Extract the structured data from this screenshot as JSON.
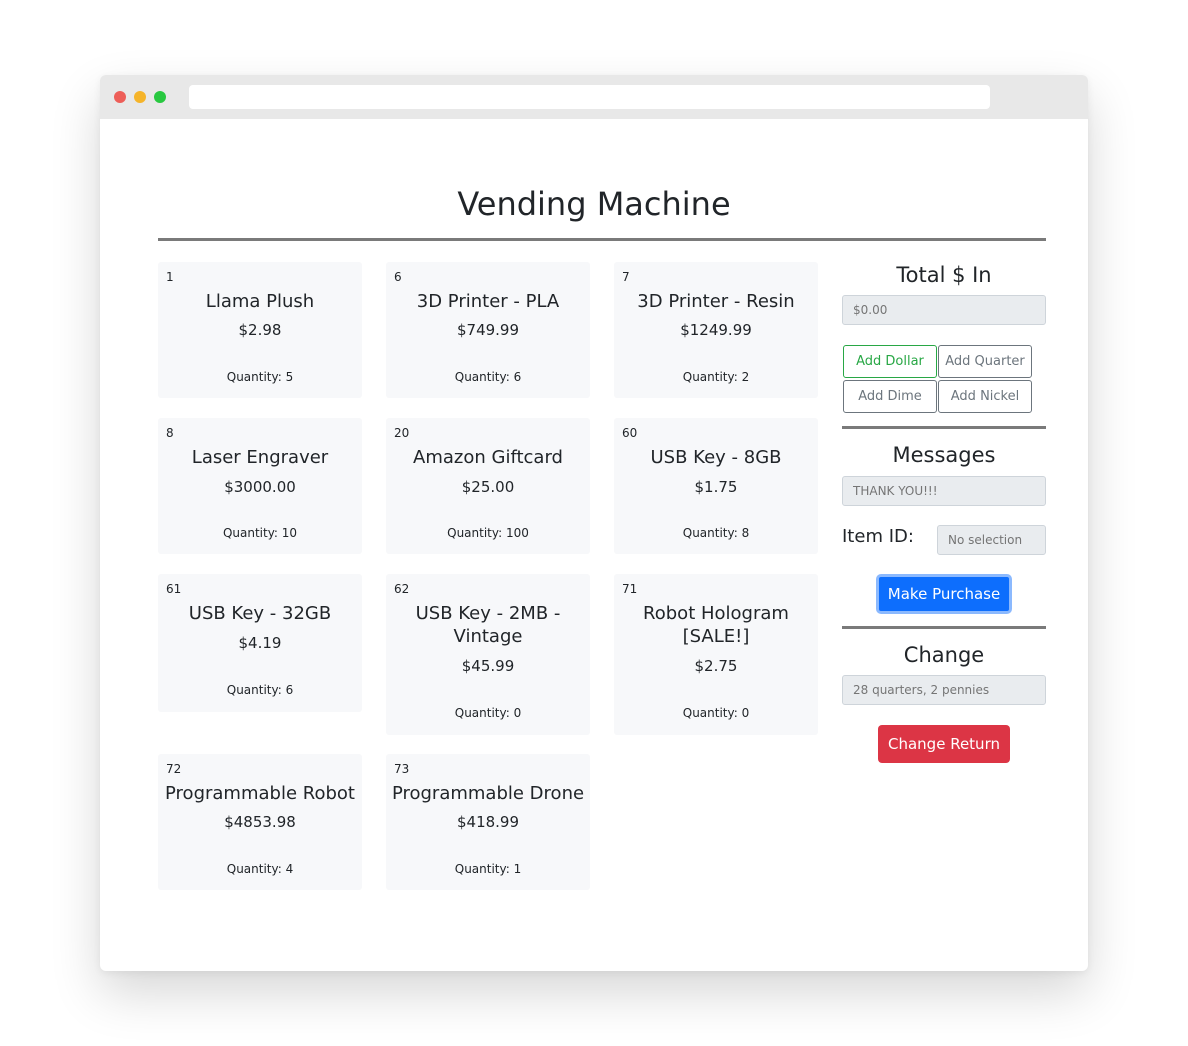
{
  "page": {
    "title": "Vending Machine"
  },
  "items": [
    {
      "id": "1",
      "name": "Llama Plush",
      "price": "$2.98",
      "quantity": "Quantity: 5"
    },
    {
      "id": "6",
      "name": "3D Printer - PLA",
      "price": "$749.99",
      "quantity": "Quantity: 6"
    },
    {
      "id": "7",
      "name": "3D Printer - Resin",
      "price": "$1249.99",
      "quantity": "Quantity: 2"
    },
    {
      "id": "8",
      "name": "Laser Engraver",
      "price": "$3000.00",
      "quantity": "Quantity: 10"
    },
    {
      "id": "20",
      "name": "Amazon Giftcard",
      "price": "$25.00",
      "quantity": "Quantity: 100"
    },
    {
      "id": "60",
      "name": "USB Key - 8GB",
      "price": "$1.75",
      "quantity": "Quantity: 8"
    },
    {
      "id": "61",
      "name": "USB Key - 32GB",
      "price": "$4.19",
      "quantity": "Quantity: 6"
    },
    {
      "id": "62",
      "name": "USB Key - 2MB - Vintage",
      "price": "$45.99",
      "quantity": "Quantity: 0"
    },
    {
      "id": "71",
      "name": "Robot Hologram [SALE!]",
      "price": "$2.75",
      "quantity": "Quantity: 0"
    },
    {
      "id": "72",
      "name": "Programmable Robot",
      "price": "$4853.98",
      "quantity": "Quantity: 4"
    },
    {
      "id": "73",
      "name": "Programmable Drone",
      "price": "$418.99",
      "quantity": "Quantity: 1"
    }
  ],
  "money": {
    "heading": "Total $ In",
    "total_placeholder": "$0.00",
    "add_dollar": "Add Dollar",
    "add_quarter": "Add Quarter",
    "add_dime": "Add Dime",
    "add_nickel": "Add Nickel"
  },
  "messages": {
    "heading": "Messages",
    "message_placeholder": "THANK YOU!!!",
    "item_id_label": "Item ID:",
    "item_id_placeholder": "No selection",
    "purchase_label": "Make Purchase"
  },
  "change": {
    "heading": "Change",
    "change_placeholder": "28 quarters, 2 pennies",
    "return_label": "Change Return"
  },
  "colors": {
    "primary": "#0d6efd",
    "danger": "#dc3545",
    "success": "#28a745",
    "secondary": "#6c757d",
    "card_bg": "#f7f8fa"
  }
}
